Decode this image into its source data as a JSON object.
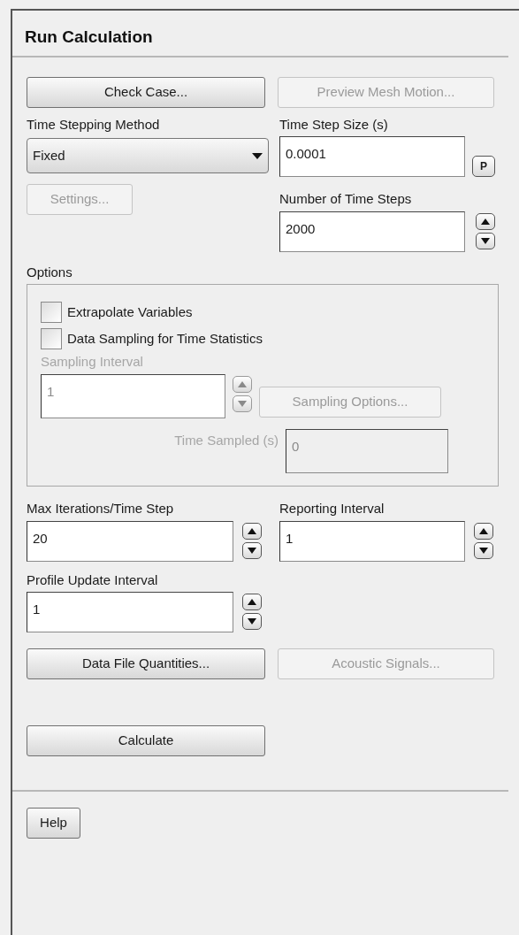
{
  "title": "Run Calculation",
  "top_buttons": [
    {
      "label": "Check Case...",
      "disabled": false
    },
    {
      "label": "Preview Mesh Motion...",
      "disabled": true
    }
  ],
  "time_stepping_method": {
    "label": "Time Stepping Method",
    "value": "Fixed"
  },
  "settings_button": {
    "label": "Settings...",
    "disabled": true
  },
  "time_step_size": {
    "label": "Time Step Size (s)",
    "value": "0.0001",
    "parameter_button": "P"
  },
  "number_of_time_steps": {
    "label": "Number of Time Steps",
    "value": "2000"
  },
  "options": {
    "label": "Options",
    "checkboxes": [
      {
        "label": "Extrapolate Variables",
        "checked": false
      },
      {
        "label": "Data Sampling for Time Statistics",
        "checked": false
      }
    ],
    "sampling_interval": {
      "label": "Sampling Interval",
      "value": "1",
      "disabled": true
    },
    "sampling_options_button": {
      "label": "Sampling Options...",
      "disabled": true
    },
    "time_sampled": {
      "label": "Time Sampled (s)",
      "value": "0",
      "disabled": true
    }
  },
  "max_iterations": {
    "label": "Max Iterations/Time Step",
    "value": "20"
  },
  "reporting_interval": {
    "label": "Reporting Interval",
    "value": "1"
  },
  "profile_update_interval": {
    "label": "Profile Update Interval",
    "value": "1"
  },
  "bottom_buttons": [
    {
      "label": "Data File Quantities...",
      "disabled": false
    },
    {
      "label": "Acoustic Signals...",
      "disabled": true
    }
  ],
  "calculate_button": {
    "label": "Calculate",
    "disabled": false
  },
  "help_button": {
    "label": "Help",
    "disabled": false
  }
}
